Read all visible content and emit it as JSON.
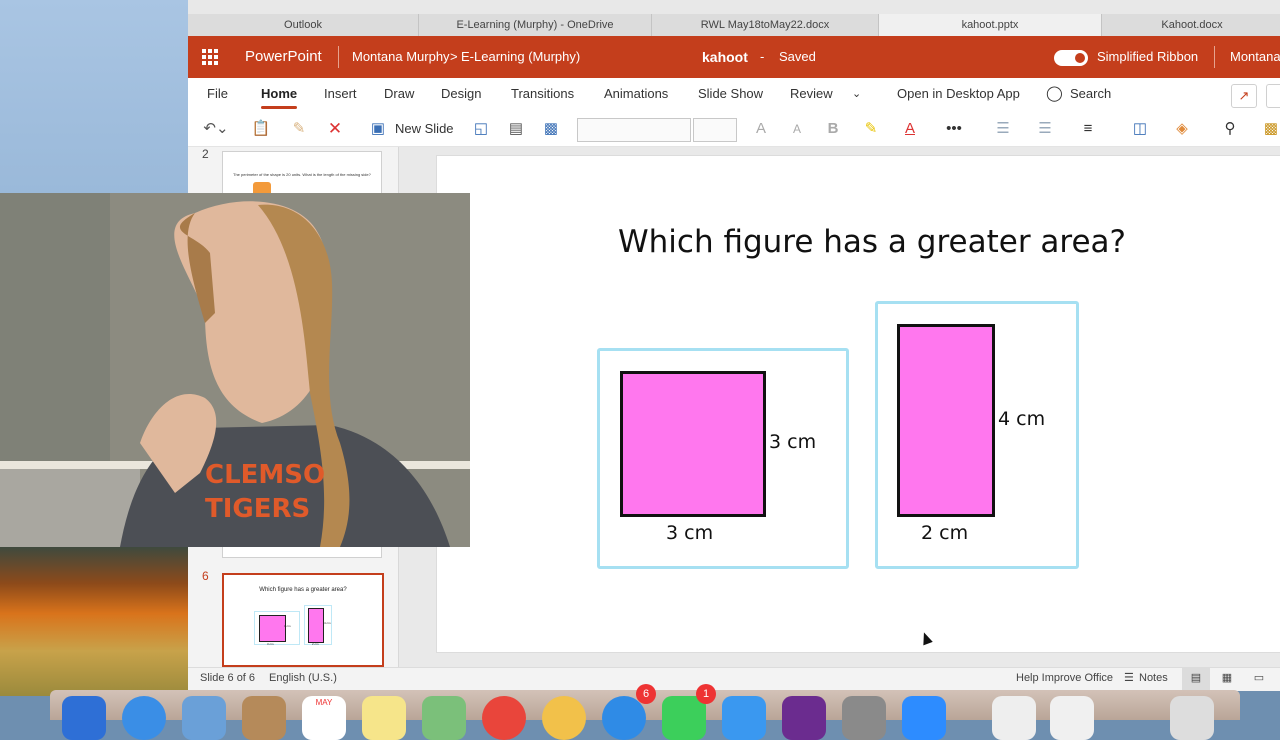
{
  "browser_tabs": [
    "Outlook",
    "E-Learning (Murphy) - OneDrive",
    "RWL May18toMay22.docx",
    "kahoot.pptx",
    "Kahoot.docx"
  ],
  "header": {
    "app_name": "PowerPoint",
    "breadcrumb_owner": "Montana Murphy",
    "breadcrumb_separator": ">",
    "breadcrumb_folder": "E-Learning (Murphy)",
    "file_name": "kahoot",
    "save_separator": "-",
    "save_status": "Saved",
    "simplified_ribbon_label": "Simplified Ribbon",
    "user_name": "Montana",
    "accent_color": "#c43e1c"
  },
  "menu": {
    "items": [
      "File",
      "Home",
      "Insert",
      "Draw",
      "Design",
      "Transitions",
      "Animations",
      "Slide Show",
      "Review"
    ],
    "active": "Home",
    "open_desktop": "Open in Desktop App",
    "search_label": "Search"
  },
  "toolbar": {
    "new_slide_label": "New Slide",
    "font_grow": "A",
    "font_shrink": "A",
    "bold": "B",
    "font_color": "A",
    "more": "•••"
  },
  "thumbnails": {
    "slide2_number": "2",
    "slide2_text": "The perimeter of the shape is 20 units. What is the length of the missing side?",
    "slide6_number": "6",
    "slide6_title": "Which figure has a greater area?",
    "slide6_labels": [
      "3 cm",
      "3 cm",
      "4 cm",
      "2 cm"
    ]
  },
  "slide": {
    "title": "Which figure has a greater area?",
    "figure1": {
      "side_label": "3 cm",
      "bottom_label": "3 cm"
    },
    "figure2": {
      "side_label": "4 cm",
      "bottom_label": "2 cm"
    },
    "fill_color": "#ff77ee",
    "frame_color": "#a6e0f2"
  },
  "status": {
    "slide_count": "Slide 6 of 6",
    "language": "English (U.S.)",
    "help_improve": "Help Improve Office",
    "notes": "Notes"
  },
  "webcam": {
    "shirt_line1": "CLEMSO",
    "shirt_line2": "TIGERS"
  },
  "dock": {
    "calendar_month": "MAY",
    "badge_a": "6",
    "badge_b": "1"
  }
}
